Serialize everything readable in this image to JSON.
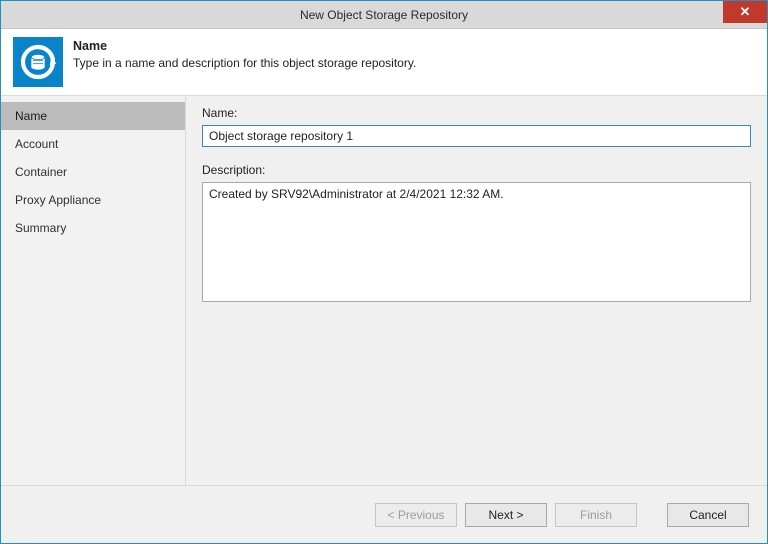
{
  "window": {
    "title": "New Object Storage Repository",
    "close_symbol": "✕"
  },
  "header": {
    "title": "Name",
    "subtitle": "Type in a name and description for this object storage repository."
  },
  "sidebar": {
    "steps": [
      {
        "label": "Name"
      },
      {
        "label": "Account"
      },
      {
        "label": "Container"
      },
      {
        "label": "Proxy Appliance"
      },
      {
        "label": "Summary"
      }
    ]
  },
  "form": {
    "name_label": "Name:",
    "name_value": "Object storage repository 1",
    "desc_label": "Description:",
    "desc_value": "Created by SRV92\\Administrator at 2/4/2021 12:32 AM."
  },
  "buttons": {
    "previous": "< Previous",
    "next": "Next >",
    "finish": "Finish",
    "cancel": "Cancel"
  }
}
